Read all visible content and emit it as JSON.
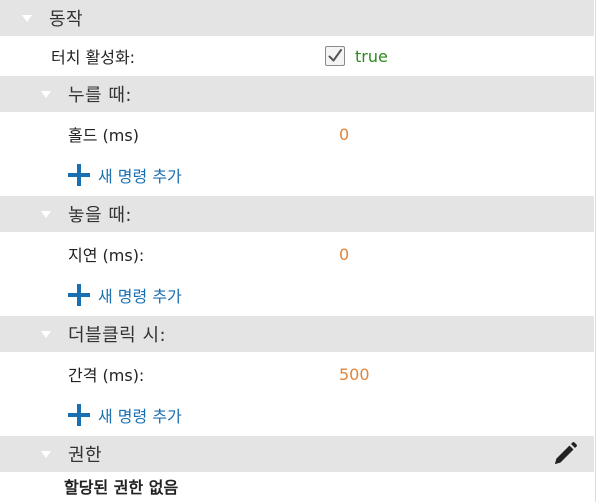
{
  "behavior": {
    "title": "동작",
    "touch_enabled": {
      "label": "터치 활성화:",
      "value": "true"
    },
    "on_press": {
      "title": "누를 때:",
      "hold_label": "홀드 (ms)",
      "hold_value": "0",
      "add_command": "새 명령 추가"
    },
    "on_release": {
      "title": "놓을 때:",
      "delay_label": "지연 (ms):",
      "delay_value": "0",
      "add_command": "새 명령 추가"
    },
    "on_double_click": {
      "title": "더블클릭 시:",
      "interval_label": "간격 (ms):",
      "interval_value": "500",
      "add_command": "새 명령 추가"
    }
  },
  "permissions": {
    "title": "권한",
    "empty_text": "할당된 권한 없음"
  },
  "icons": {
    "collapse": "triangle-down-icon",
    "add": "plus-icon",
    "edit": "pencil-icon",
    "checkbox": "checkmark-icon"
  },
  "colors": {
    "header_bg": "#e4e4e4",
    "number_value": "#e0843c",
    "boolean_value": "#2e8a1e",
    "link": "#1a6fb0"
  }
}
